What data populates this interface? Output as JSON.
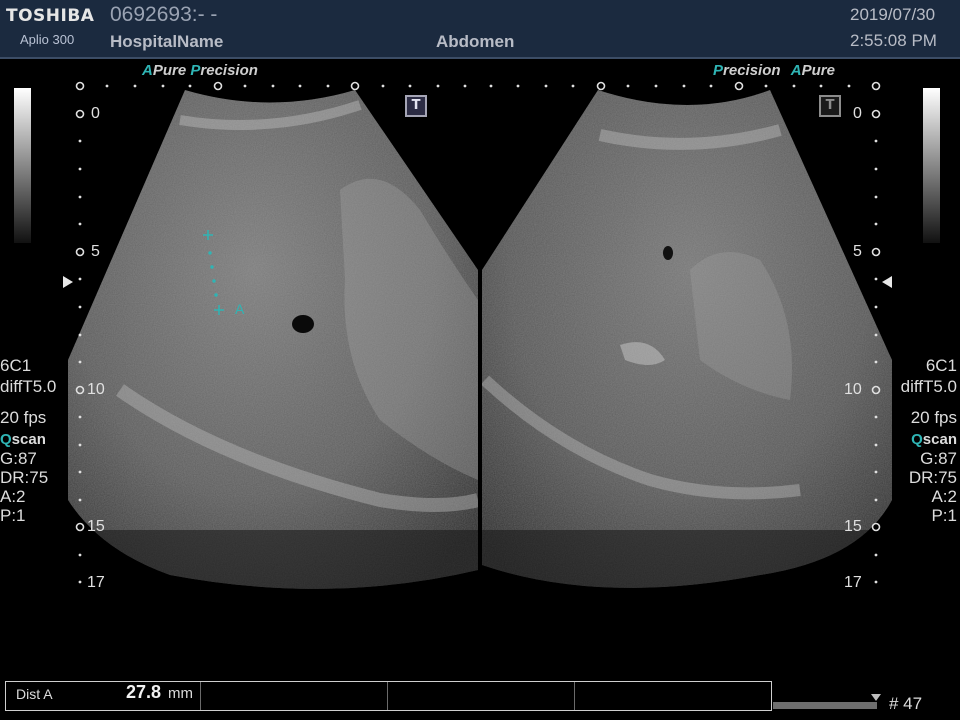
{
  "header": {
    "brand": "TOSHIBA",
    "model": "Aplio 300",
    "patient_id": "0692693:- -",
    "hospital": "HospitalName",
    "exam": "Abdomen",
    "date": "2019/07/30",
    "time": "2:55:08 PM"
  },
  "left_image": {
    "tag_a": "A",
    "tag_pure": "Pure",
    "tag_p": "P",
    "tag_precision": "recision",
    "t_marker": "T",
    "caliper_label": "A"
  },
  "right_image": {
    "tag_p": "P",
    "tag_precision": "recision",
    "tag_a": "A",
    "tag_pure": "Pure",
    "t_marker": "T"
  },
  "depth_scale": {
    "labels": [
      "0",
      "5",
      "10",
      "15",
      "17"
    ]
  },
  "left_params": {
    "probe": "6C1",
    "filter": "diffT5.0",
    "fps": "20 fps",
    "qscan_q": "Q",
    "qscan_rest": "scan",
    "gain": "G:87",
    "dr": "DR:75",
    "a": "A:2",
    "p": "P:1"
  },
  "right_params": {
    "probe": "6C1",
    "filter": "diffT5.0",
    "fps": "20 fps",
    "qscan_q": "Q",
    "qscan_rest": "scan",
    "gain": "G:87",
    "dr": "DR:75",
    "a": "A:2",
    "p": "P:1"
  },
  "measurement": {
    "label": "Dist A",
    "value": "27.8",
    "unit": "mm"
  },
  "footer": {
    "frame": "# 47"
  },
  "colors": {
    "header_bg": "#1b2a3f",
    "accent_cyan": "#2fb5b5",
    "tissue_gray": "#8a8a8a"
  }
}
